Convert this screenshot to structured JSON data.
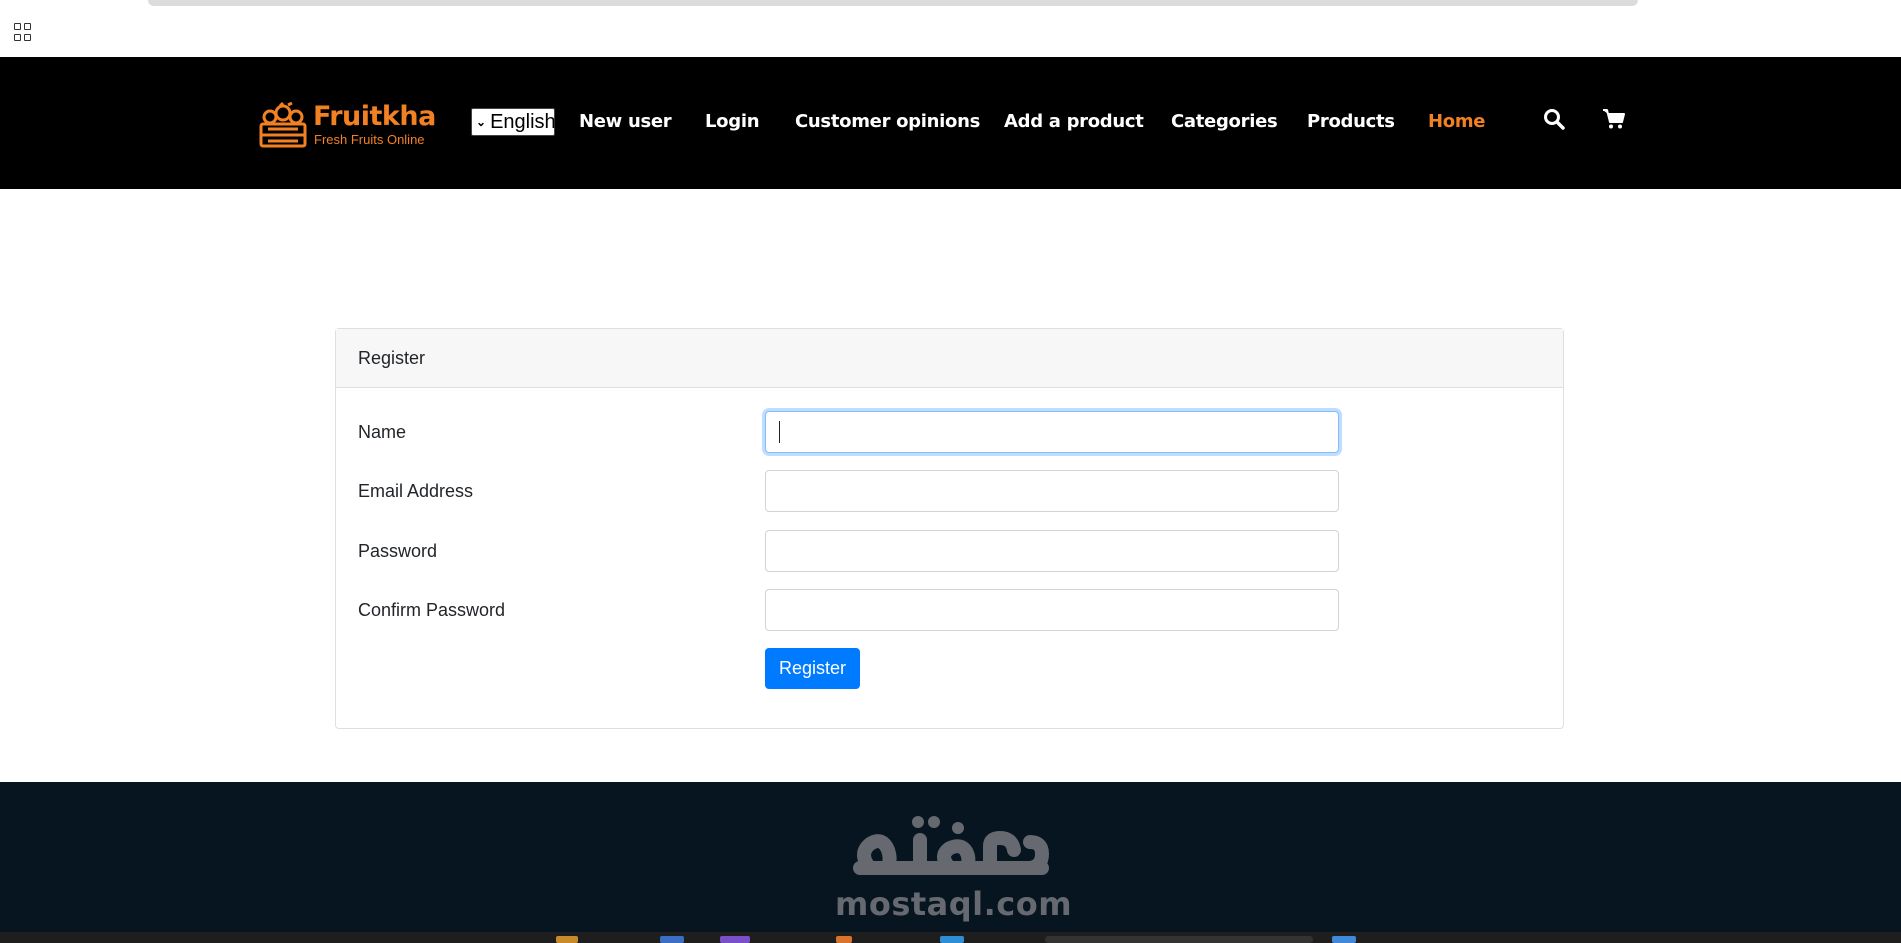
{
  "brand": {
    "name": "Fruitkha",
    "tagline": "Fresh Fruits Online",
    "accent_color": "#F28123"
  },
  "language_selector": {
    "selected": "English"
  },
  "nav": {
    "items": [
      {
        "label": "New user"
      },
      {
        "label": "Login"
      },
      {
        "label": "Customer opinions"
      },
      {
        "label": "Add a product"
      },
      {
        "label": "Categories"
      },
      {
        "label": "Products"
      },
      {
        "label": "Home",
        "active": true
      }
    ],
    "icons": [
      "search-icon",
      "cart-icon"
    ]
  },
  "register_card": {
    "header": "Register",
    "fields": [
      {
        "label": "Name",
        "value": "",
        "focused": true
      },
      {
        "label": "Email Address",
        "value": ""
      },
      {
        "label": "Password",
        "value": ""
      },
      {
        "label": "Confirm Password",
        "value": ""
      }
    ],
    "submit_label": "Register",
    "button_color": "#007bff"
  },
  "watermark": {
    "latin": "mostaql.com"
  }
}
